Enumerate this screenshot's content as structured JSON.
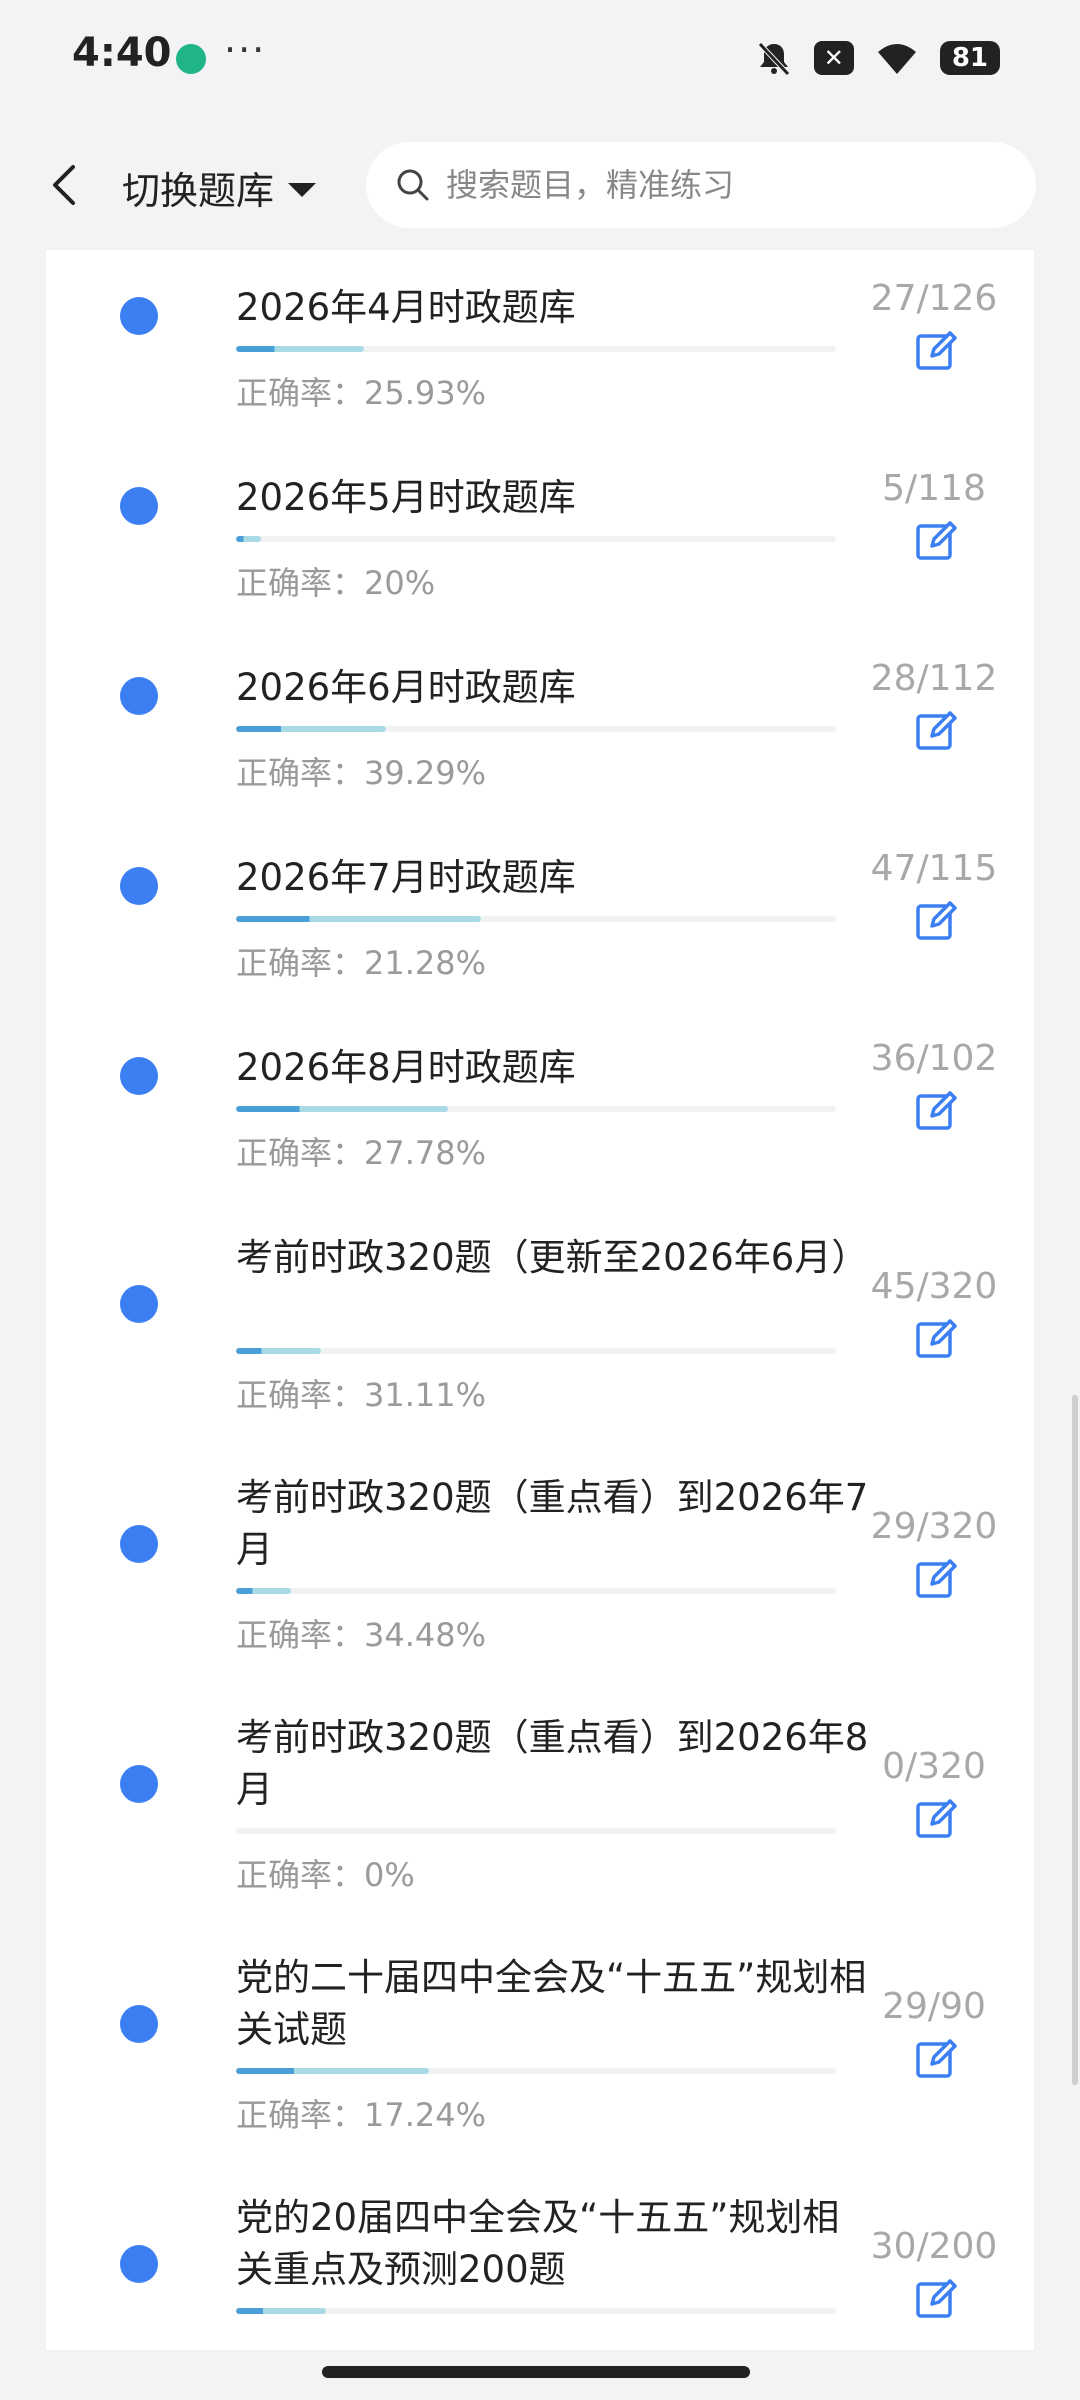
{
  "status": {
    "time": "4:40",
    "more": "···",
    "battery": "81"
  },
  "header": {
    "switch_label": "切换题库",
    "search_placeholder": "搜索题目，精准练习"
  },
  "items": [
    {
      "title": "2026年4月时政题库",
      "rate": "正确率：25.93%",
      "count": "27/126",
      "progress": 0.214
    },
    {
      "title": "2026年5月时政题库",
      "rate": "正确率：20%",
      "count": "5/118",
      "progress": 0.042
    },
    {
      "title": "2026年6月时政题库",
      "rate": "正确率：39.29%",
      "count": "28/112",
      "progress": 0.25
    },
    {
      "title": "2026年7月时政题库",
      "rate": "正确率：21.28%",
      "count": "47/115",
      "progress": 0.409
    },
    {
      "title": "2026年8月时政题库",
      "rate": "正确率：27.78%",
      "count": "36/102",
      "progress": 0.353
    },
    {
      "title": "考前时政320题（更新至2026年6月）",
      "rate": "正确率：31.11%",
      "count": "45/320",
      "progress": 0.141
    },
    {
      "title": "考前时政320题（重点看）到2026年7月",
      "rate": "正确率：34.48%",
      "count": "29/320",
      "progress": 0.091
    },
    {
      "title": "考前时政320题（重点看）到2026年8月",
      "rate": "正确率：0%",
      "count": "0/320",
      "progress": 0
    },
    {
      "title": "党的二十届四中全会及“十五五”规划相关试题",
      "rate": "正确率：17.24%",
      "count": "29/90",
      "progress": 0.322
    },
    {
      "title": "党的20届四中全会及“十五五”规划相关重点及预测200题",
      "rate": "",
      "count": "30/200",
      "progress": 0.15
    }
  ]
}
